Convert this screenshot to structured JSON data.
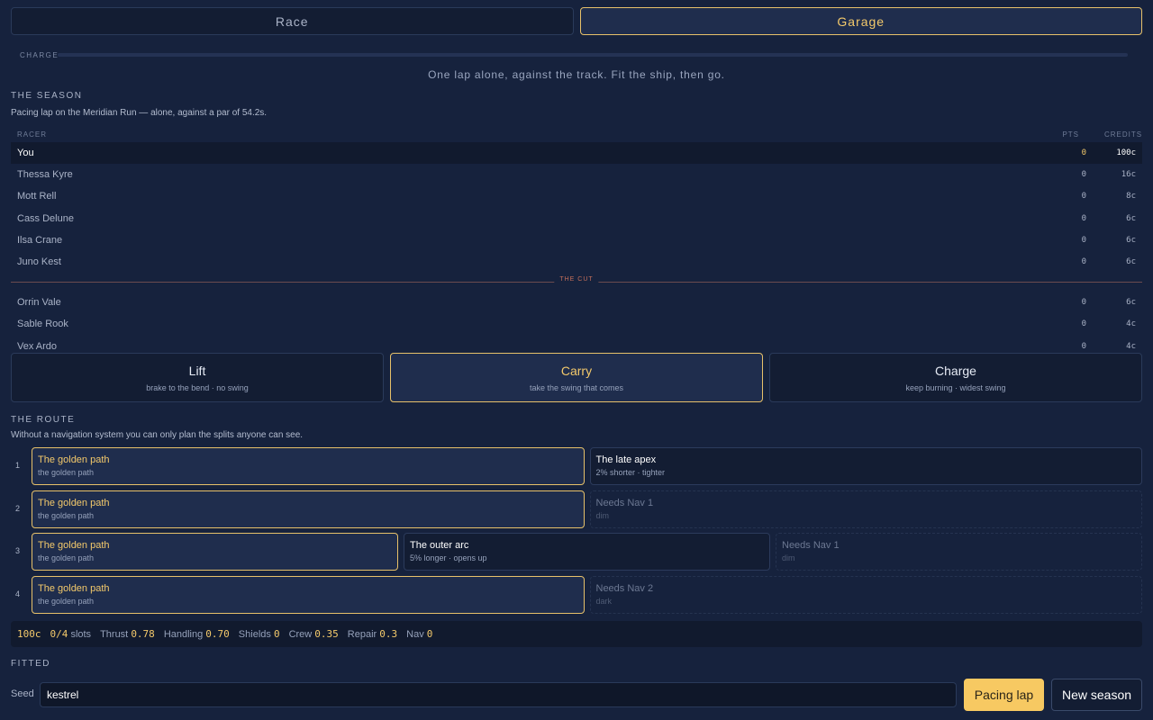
{
  "tabs": [
    {
      "label": "Race",
      "active": false
    },
    {
      "label": "Garage",
      "active": true
    }
  ],
  "charge": {
    "label": "CHARGE",
    "fraction": 0
  },
  "tagline": "One lap alone, against the track. Fit the ship, then go.",
  "season": {
    "title": "THE SEASON",
    "subtitle": "Pacing lap on the Meridian Run — alone, against a par of 54.2s.",
    "headers": {
      "racer": "RACER",
      "pts": "PTS",
      "credits": "CREDITS"
    },
    "cut_label": "THE CUT",
    "above_cut": [
      {
        "name": "You",
        "pts": "0",
        "credits": "100c",
        "me": true
      },
      {
        "name": "Thessa Kyre",
        "pts": "0",
        "credits": "16c"
      },
      {
        "name": "Mott Rell",
        "pts": "0",
        "credits": "8c"
      },
      {
        "name": "Cass Delune",
        "pts": "0",
        "credits": "6c"
      },
      {
        "name": "Ilsa Crane",
        "pts": "0",
        "credits": "6c"
      },
      {
        "name": "Juno Kest",
        "pts": "0",
        "credits": "6c"
      }
    ],
    "below_cut": [
      {
        "name": "Orrin Vale",
        "pts": "0",
        "credits": "6c"
      },
      {
        "name": "Sable Rook",
        "pts": "0",
        "credits": "4c"
      },
      {
        "name": "Vex Ardo",
        "pts": "0",
        "credits": "4c"
      }
    ]
  },
  "stances": [
    {
      "title": "Lift",
      "sub": "brake to the bend · no swing",
      "active": false
    },
    {
      "title": "Carry",
      "sub": "take the swing that comes",
      "active": true
    },
    {
      "title": "Charge",
      "sub": "keep burning · widest swing",
      "active": false
    }
  ],
  "route": {
    "title": "THE ROUTE",
    "subtitle": "Without a navigation system you can only plan the splits anyone can see.",
    "rows": [
      {
        "num": "1",
        "options": [
          {
            "title": "The golden path",
            "sub": "the golden path",
            "state": "sel"
          },
          {
            "title": "The late apex",
            "sub": "2% shorter · tighter",
            "state": "open"
          }
        ]
      },
      {
        "num": "2",
        "options": [
          {
            "title": "The golden path",
            "sub": "the golden path",
            "state": "sel"
          },
          {
            "title": "Needs Nav 1",
            "sub": "dim",
            "state": "locked"
          }
        ]
      },
      {
        "num": "3",
        "options": [
          {
            "title": "The golden path",
            "sub": "the golden path",
            "state": "sel"
          },
          {
            "title": "The outer arc",
            "sub": "5% longer · opens up",
            "state": "open"
          },
          {
            "title": "Needs Nav 1",
            "sub": "dim",
            "state": "locked"
          }
        ]
      },
      {
        "num": "4",
        "options": [
          {
            "title": "The golden path",
            "sub": "the golden path",
            "state": "sel"
          },
          {
            "title": "Needs Nav 2",
            "sub": "dark",
            "state": "locked"
          }
        ]
      }
    ]
  },
  "stats": {
    "credits": "100c",
    "slots": "0/4",
    "slots_label": "slots",
    "items": [
      {
        "label": "Thrust",
        "value": "0.78"
      },
      {
        "label": "Handling",
        "value": "0.70"
      },
      {
        "label": "Shields",
        "value": "0"
      },
      {
        "label": "Crew",
        "value": "0.35"
      },
      {
        "label": "Repair",
        "value": "0.3"
      },
      {
        "label": "Nav",
        "value": "0"
      }
    ]
  },
  "fitted": {
    "title": "FITTED"
  },
  "seed": {
    "label": "Seed",
    "value": "kestrel"
  },
  "buttons": {
    "primary": "Pacing lap",
    "secondary": "New season"
  },
  "colors": {
    "accent": "#f3c96b",
    "background": "#16223d",
    "cut": "#c46f5a"
  }
}
